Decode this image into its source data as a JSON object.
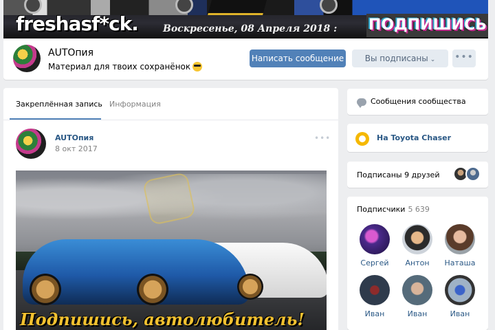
{
  "cover": {
    "brand": "freshasf*ck.",
    "date": "Воскресенье, 08 Апреля 2018 :",
    "subscribe_banner": "ПОДПИШИСЬ"
  },
  "header": {
    "group_name": "AUTOпия",
    "status": "Материал для твоих сохранёнок",
    "status_emoji": "sunglasses-emoji",
    "write_message_label": "Написать сообщение",
    "subscribed_label": "Вы подписаны",
    "more_label": "•••"
  },
  "tabs": [
    {
      "label": "Закреплённая запись",
      "active": true
    },
    {
      "label": "Информация",
      "active": false
    }
  ],
  "post": {
    "author": "AUTOпия",
    "date": "8 окт 2017",
    "more_label": "•••",
    "image_caption": "Подпишись, автолюбитель!"
  },
  "sidebar": {
    "messages_label": "Сообщения сообщества",
    "link_label": "На Toyota Chaser",
    "friends_label": "Подписаны 9 друзей",
    "subscribers_label": "Подписчики",
    "subscribers_count": "5 639",
    "members": [
      {
        "name": "Сергей"
      },
      {
        "name": "Антон"
      },
      {
        "name": "Наташа"
      },
      {
        "name": "Иван"
      },
      {
        "name": "Иван"
      },
      {
        "name": "Иван"
      }
    ]
  },
  "colors": {
    "accent": "#5181b8",
    "link": "#2a5885",
    "background": "#edeef0",
    "secondary_button": "#e5ebf1"
  }
}
